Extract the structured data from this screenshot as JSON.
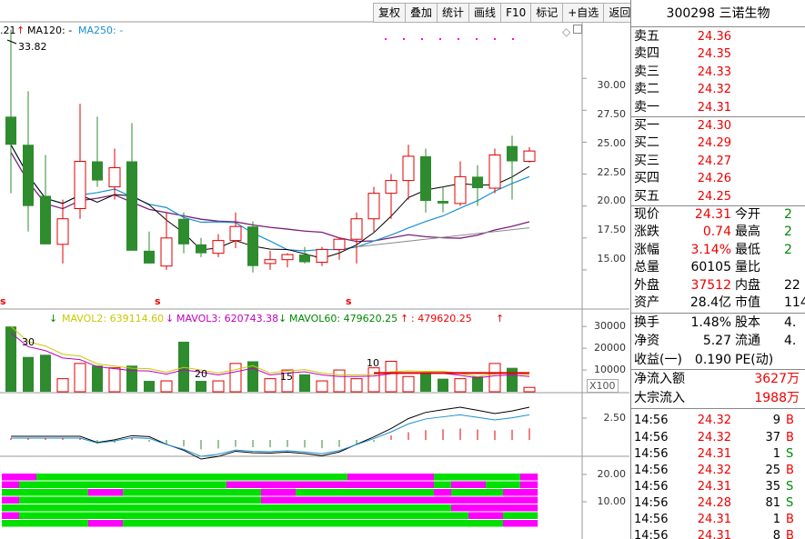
{
  "toolbar": [
    "复权",
    "叠加",
    "统计",
    "画线",
    "F10",
    "标记",
    "+自选",
    "返回"
  ],
  "chart": {
    "ma_legend": {
      "prefix": ".21",
      "ma120": "MA120: -",
      "ma250": "MA250: -"
    },
    "high_label": "33.82",
    "price_axis": [
      "30.00",
      "27.50",
      "25.00",
      "22.50",
      "20.00",
      "17.50",
      "15.00"
    ],
    "vol_legend": {
      "mavol2": "MAVOL2: 639114.60",
      "mavol3": "MAVOL3: 620743.38",
      "mavol60": "MAVOL60: 479620.25",
      "extra": ": 479620.25"
    },
    "vol_axis": [
      "30000",
      "20000",
      "10000"
    ],
    "vol_multiplier": "X100",
    "vol_peak_labels": [
      "30",
      "20",
      "15",
      "10"
    ],
    "macd_axis": [
      "2.50"
    ],
    "bottom_axis": [
      "20.00",
      "10.00"
    ],
    "s_markers": [
      "s",
      "s",
      "s"
    ],
    "colors": {
      "up": "#e00000",
      "down": "#2e8b2e",
      "ma5": "#000000",
      "ma10": "#1a8fd6",
      "ma20": "#7a1f7a",
      "magenta": "#ff00ff",
      "green_bar": "#00e000"
    }
  },
  "chart_data": {
    "type": "candlestick",
    "title": "",
    "ohlc": [
      [
        27.0,
        33.8,
        21.0,
        24.8
      ],
      [
        24.8,
        29.0,
        18.0,
        20.0
      ],
      [
        20.8,
        24.0,
        17.0,
        17.0
      ],
      [
        17.0,
        20.5,
        15.5,
        19.0
      ],
      [
        19.8,
        28.0,
        19.0,
        23.5
      ],
      [
        23.5,
        27.0,
        21.5,
        22.0
      ],
      [
        21.5,
        24.5,
        20.5,
        23.0
      ],
      [
        23.5,
        26.5,
        19.5,
        16.5
      ],
      [
        16.5,
        18.0,
        15.5,
        15.5
      ],
      [
        15.3,
        19.5,
        15.0,
        17.5
      ],
      [
        19.0,
        19.5,
        16.3,
        17.0
      ],
      [
        17.0,
        17.5,
        16.0,
        16.3
      ],
      [
        16.3,
        17.8,
        16.0,
        17.3
      ],
      [
        17.3,
        19.5,
        16.7,
        18.4
      ],
      [
        18.4,
        18.8,
        14.8,
        15.3
      ],
      [
        15.5,
        16.5,
        15.0,
        15.8
      ],
      [
        15.8,
        16.3,
        15.2,
        16.2
      ],
      [
        16.2,
        16.8,
        15.5,
        15.6
      ],
      [
        15.6,
        16.8,
        15.3,
        16.6
      ],
      [
        16.6,
        17.5,
        15.8,
        17.4
      ],
      [
        17.4,
        19.5,
        15.5,
        19.0
      ],
      [
        19.0,
        21.5,
        18.0,
        21.0
      ],
      [
        21.0,
        22.5,
        19.0,
        22.0
      ],
      [
        22.0,
        24.8,
        20.5,
        23.9
      ],
      [
        23.9,
        24.5,
        19.5,
        20.4
      ],
      [
        20.4,
        21.5,
        19.5,
        20.2
      ],
      [
        20.2,
        23.5,
        20.0,
        22.3
      ],
      [
        22.3,
        23.2,
        20.0,
        21.4
      ],
      [
        21.4,
        24.5,
        21.0,
        24.0
      ],
      [
        24.7,
        25.5,
        20.5,
        23.5
      ],
      [
        23.5,
        24.6,
        23.4,
        24.31
      ]
    ],
    "volume": [
      30,
      16,
      17,
      6,
      13,
      12,
      11,
      12,
      5,
      5,
      23,
      5,
      5,
      13,
      14,
      6,
      10,
      8,
      5,
      10,
      6,
      11,
      14,
      7,
      9,
      6,
      6,
      7,
      13,
      11,
      2
    ],
    "ylim": [
      13.5,
      34.0
    ],
    "vol_ylim": [
      0,
      33000
    ]
  },
  "panel": {
    "code_name": "300298 三诺生物",
    "sell": [
      {
        "name": "卖五",
        "price": "24.36"
      },
      {
        "name": "卖四",
        "price": "24.35"
      },
      {
        "name": "卖三",
        "price": "24.33"
      },
      {
        "name": "卖二",
        "price": "24.32"
      },
      {
        "name": "卖一",
        "price": "24.31"
      }
    ],
    "buy": [
      {
        "name": "买一",
        "price": "24.30"
      },
      {
        "name": "买二",
        "price": "24.29"
      },
      {
        "name": "买三",
        "price": "24.27"
      },
      {
        "name": "买四",
        "price": "24.26"
      },
      {
        "name": "买五",
        "price": "24.25"
      }
    ],
    "quote": [
      {
        "l1": "现价",
        "v1": "24.31",
        "l2": "今开",
        "v2": "2"
      },
      {
        "l1": "涨跌",
        "v1": "0.74",
        "l2": "最高",
        "v2": "2"
      },
      {
        "l1": "涨幅",
        "v1": "3.14%",
        "l2": "最低",
        "v2": "2"
      },
      {
        "l1": "总量",
        "v1": "60105",
        "l2": "量比",
        "v2": ""
      },
      {
        "l1": "外盘",
        "v1": "37512",
        "l2": "内盘",
        "v2": "22"
      },
      {
        "l1": "资产",
        "v1": "28.4亿",
        "l2": "市值",
        "v2": "114"
      }
    ],
    "stats": [
      {
        "l1": "换手",
        "v1": "1.48%",
        "l2": "股本",
        "v2": "4."
      },
      {
        "l1": "净资",
        "v1": "5.27",
        "l2": "流通",
        "v2": "4."
      },
      {
        "l1": "收益(一)",
        "v1": "0.190",
        "l2": "PE(动)",
        "v2": ""
      }
    ],
    "flows": [
      {
        "label": "净流入额",
        "value": "3627万"
      },
      {
        "label": "大宗流入",
        "value": "1988万"
      }
    ],
    "ticks": [
      {
        "time": "14:56",
        "price": "24.32",
        "vol": "9",
        "side": "B"
      },
      {
        "time": "14:56",
        "price": "24.32",
        "vol": "37",
        "side": "B"
      },
      {
        "time": "14:56",
        "price": "24.31",
        "vol": "1",
        "side": "S"
      },
      {
        "time": "14:56",
        "price": "24.32",
        "vol": "25",
        "side": "B"
      },
      {
        "time": "14:56",
        "price": "24.31",
        "vol": "35",
        "side": "S"
      },
      {
        "time": "14:56",
        "price": "24.28",
        "vol": "81",
        "side": "S"
      },
      {
        "time": "14:56",
        "price": "24.31",
        "vol": "1",
        "side": "B"
      },
      {
        "time": "14:56",
        "price": "24.31",
        "vol": "8",
        "side": "B"
      }
    ]
  }
}
